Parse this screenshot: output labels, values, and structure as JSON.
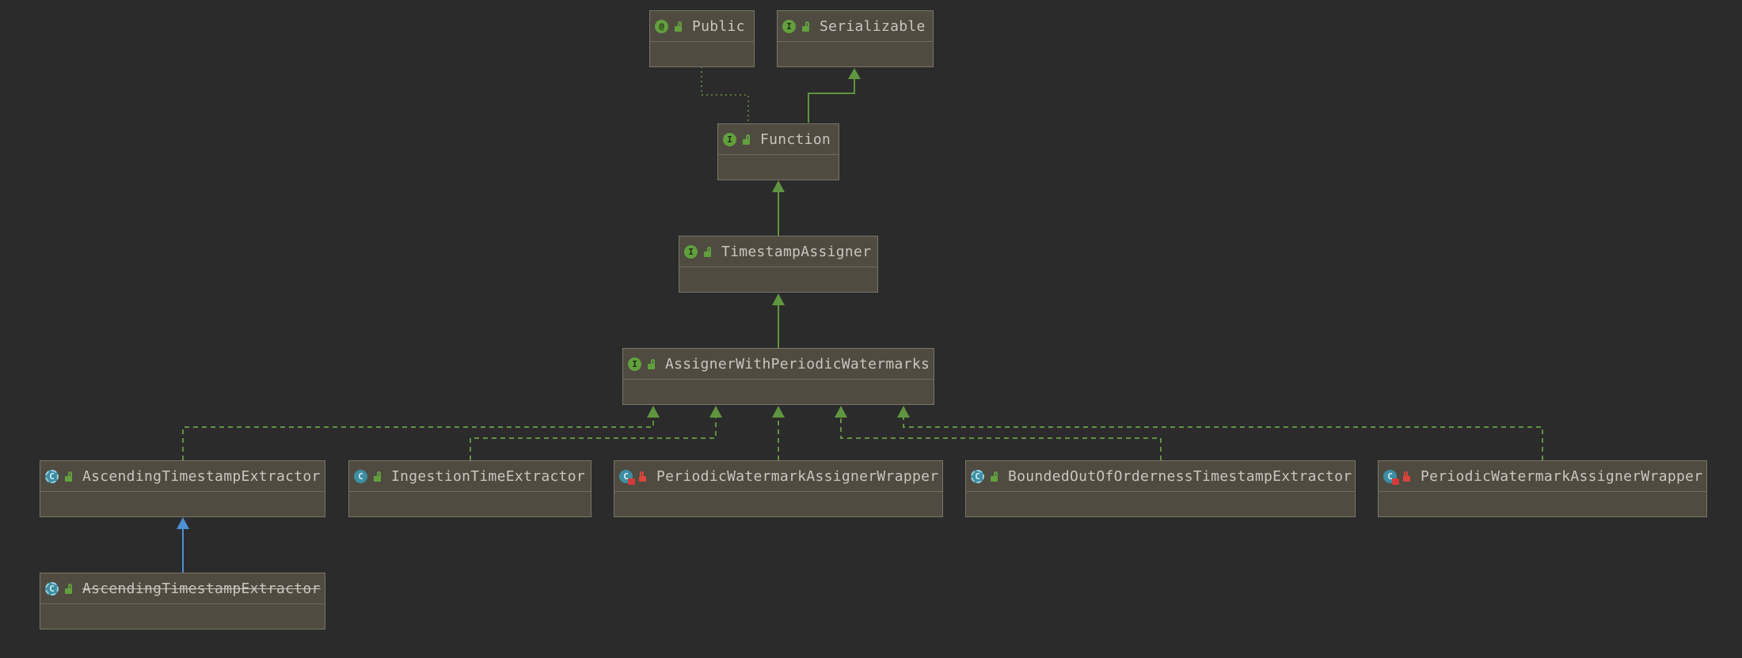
{
  "diagram": {
    "nodes": [
      {
        "id": "public",
        "label": "Public",
        "kind": "annotation",
        "kind_glyph": "@",
        "visibility": "public",
        "deprecated": false
      },
      {
        "id": "serializable",
        "label": "Serializable",
        "kind": "interface",
        "kind_glyph": "I",
        "visibility": "public",
        "deprecated": false
      },
      {
        "id": "function",
        "label": "Function",
        "kind": "interface",
        "kind_glyph": "I",
        "visibility": "public",
        "deprecated": false
      },
      {
        "id": "timestamp-assigner",
        "label": "TimestampAssigner",
        "kind": "interface",
        "kind_glyph": "I",
        "visibility": "public",
        "deprecated": false
      },
      {
        "id": "assigner-periodic",
        "label": "AssignerWithPeriodicWatermarks",
        "kind": "interface",
        "kind_glyph": "I",
        "visibility": "public",
        "deprecated": false
      },
      {
        "id": "ascending-extractor",
        "label": "AscendingTimestampExtractor",
        "kind": "abstract-class",
        "kind_glyph": "C",
        "visibility": "public",
        "deprecated": false
      },
      {
        "id": "ingestion-extractor",
        "label": "IngestionTimeExtractor",
        "kind": "class",
        "kind_glyph": "C",
        "visibility": "public",
        "deprecated": false
      },
      {
        "id": "periodic-wrapper-1",
        "label": "PeriodicWatermarkAssignerWrapper",
        "kind": "final-class",
        "kind_glyph": "C",
        "visibility": "private",
        "deprecated": false
      },
      {
        "id": "bounded-extractor",
        "label": "BoundedOutOfOrdernessTimestampExtractor",
        "kind": "abstract-class",
        "kind_glyph": "C",
        "visibility": "public",
        "deprecated": false
      },
      {
        "id": "periodic-wrapper-2",
        "label": "PeriodicWatermarkAssignerWrapper",
        "kind": "final-class",
        "kind_glyph": "C",
        "visibility": "private",
        "deprecated": false
      },
      {
        "id": "ascending-extractor-deprecated",
        "label": "AscendingTimestampExtractor",
        "kind": "abstract-class",
        "kind_glyph": "C",
        "visibility": "public",
        "deprecated": true
      }
    ],
    "edges": [
      {
        "from": "function",
        "to": "public",
        "type": "annotation"
      },
      {
        "from": "function",
        "to": "serializable",
        "type": "extends"
      },
      {
        "from": "timestamp-assigner",
        "to": "function",
        "type": "extends"
      },
      {
        "from": "assigner-periodic",
        "to": "timestamp-assigner",
        "type": "extends"
      },
      {
        "from": "ascending-extractor",
        "to": "assigner-periodic",
        "type": "implements"
      },
      {
        "from": "ingestion-extractor",
        "to": "assigner-periodic",
        "type": "implements"
      },
      {
        "from": "periodic-wrapper-1",
        "to": "assigner-periodic",
        "type": "implements"
      },
      {
        "from": "bounded-extractor",
        "to": "assigner-periodic",
        "type": "implements"
      },
      {
        "from": "periodic-wrapper-2",
        "to": "assigner-periodic",
        "type": "implements"
      },
      {
        "from": "ascending-extractor-deprecated",
        "to": "ascending-extractor",
        "type": "class-extends"
      }
    ]
  },
  "colors": {
    "background": "#2b2b2b",
    "node_fill": "#4f4b41",
    "node_border": "#7a7566",
    "edge_green": "#5f9440",
    "edge_blue": "#4f8fd6",
    "edge_dotted": "#5c7a3a",
    "text": "#c9c6bd"
  }
}
